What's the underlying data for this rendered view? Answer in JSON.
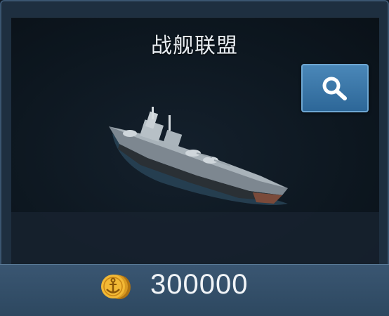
{
  "item": {
    "title": "战舰联盟",
    "price": "300000",
    "currency_icon": "anchor-coin-icon",
    "search_icon": "magnifier-icon"
  },
  "colors": {
    "card_bg": "#1e2f40",
    "price_bar": "#35506a",
    "search_button": "#3a77a8",
    "coin_gold": "#e8a82a"
  }
}
